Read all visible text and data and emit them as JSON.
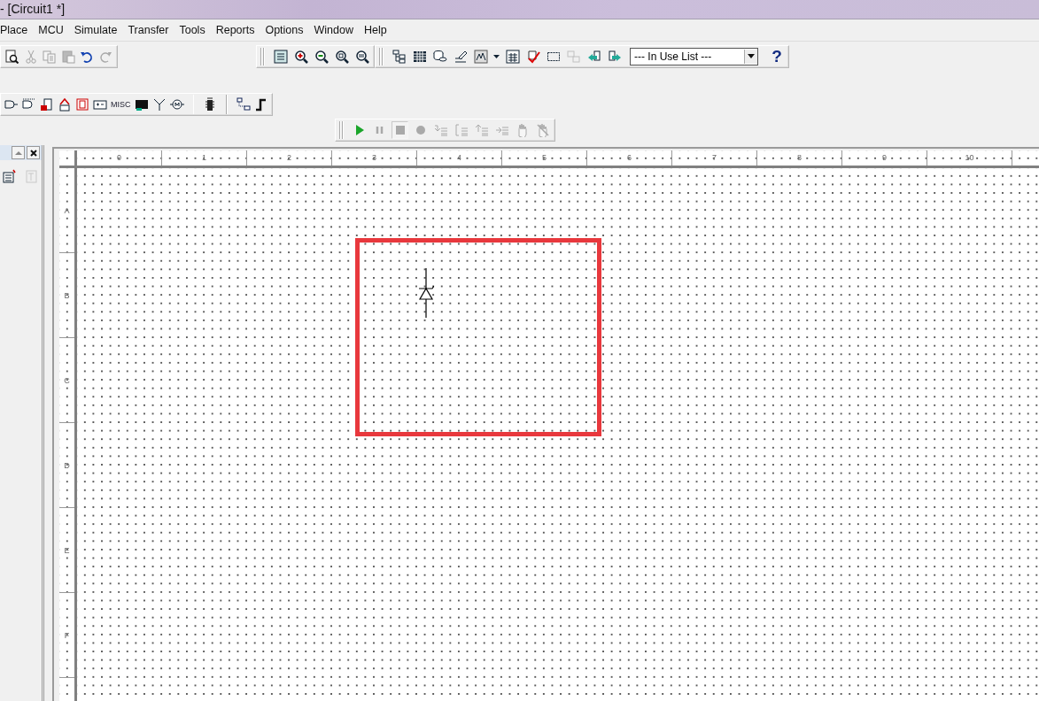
{
  "window": {
    "title": "- [Circuit1 *]"
  },
  "menu": [
    "Place",
    "MCU",
    "Simulate",
    "Transfer",
    "Tools",
    "Reports",
    "Options",
    "Window",
    "Help"
  ],
  "toolbar_edit": [
    {
      "kind": "print-preview",
      "disabled": false
    },
    {
      "kind": "cut",
      "disabled": true
    },
    {
      "kind": "copy",
      "disabled": true
    },
    {
      "kind": "paste",
      "disabled": true
    },
    {
      "kind": "undo",
      "disabled": false
    },
    {
      "kind": "redo",
      "disabled": true
    }
  ],
  "toolbar_view": [
    {
      "kind": "full-screen",
      "disabled": false
    },
    {
      "kind": "zoom-in",
      "disabled": false
    },
    {
      "kind": "zoom-out",
      "disabled": false
    },
    {
      "kind": "zoom-area",
      "disabled": false
    },
    {
      "kind": "zoom-fit",
      "disabled": false
    }
  ],
  "toolbar_main": [
    {
      "kind": "hierarchy",
      "disabled": false
    },
    {
      "kind": "spreadsheet",
      "disabled": false
    },
    {
      "kind": "database",
      "disabled": false
    },
    {
      "kind": "component-wizard",
      "disabled": false
    },
    {
      "kind": "grapher",
      "disabled": false
    },
    {
      "kind": "caret",
      "disabled": false
    },
    {
      "kind": "postprocessor",
      "disabled": false
    },
    {
      "kind": "erc",
      "disabled": false
    },
    {
      "kind": "region",
      "disabled": false
    },
    {
      "kind": "replace",
      "disabled": true
    },
    {
      "kind": "back-annotate",
      "disabled": false
    },
    {
      "kind": "forward-annotate",
      "disabled": false
    }
  ],
  "in_use_list": {
    "value": "--- In Use List ---"
  },
  "help_button": {
    "label": "?"
  },
  "toolbar_components": [
    {
      "kind": "ttl",
      "disabled": false
    },
    {
      "kind": "cmos",
      "disabled": false
    },
    {
      "kind": "digital",
      "disabled": false
    },
    {
      "kind": "mixed",
      "disabled": false
    },
    {
      "kind": "indicator",
      "disabled": false
    },
    {
      "kind": "power",
      "disabled": false
    },
    {
      "kind": "text",
      "label": "MISC",
      "disabled": false
    },
    {
      "kind": "advanced",
      "disabled": false
    },
    {
      "kind": "rf",
      "disabled": false
    },
    {
      "kind": "electromechanical",
      "disabled": false
    },
    {
      "kind": "separator"
    },
    {
      "kind": "mcu",
      "disabled": false
    },
    {
      "kind": "separator"
    },
    {
      "kind": "hierarchical-block",
      "disabled": false
    },
    {
      "kind": "bus",
      "disabled": false
    }
  ],
  "toolbar_simulation": [
    {
      "kind": "run",
      "disabled": false,
      "pressed": false
    },
    {
      "kind": "pause",
      "disabled": true,
      "pressed": false
    },
    {
      "kind": "stop",
      "disabled": true,
      "pressed": true
    },
    {
      "kind": "record",
      "disabled": true,
      "pressed": false
    },
    {
      "kind": "step-into",
      "disabled": true,
      "pressed": false
    },
    {
      "kind": "step-over",
      "disabled": true,
      "pressed": false
    },
    {
      "kind": "step-out",
      "disabled": true,
      "pressed": false
    },
    {
      "kind": "run-to-cursor",
      "disabled": true,
      "pressed": false
    },
    {
      "kind": "breakpoint",
      "disabled": true,
      "pressed": false
    },
    {
      "kind": "remove-breakpoints",
      "disabled": true,
      "pressed": false
    }
  ],
  "side_panel": {
    "buttons": [
      {
        "kind": "scroll-up"
      },
      {
        "kind": "close"
      }
    ],
    "tools": [
      {
        "kind": "new-sheet",
        "disabled": false
      },
      {
        "kind": "sheet-text",
        "disabled": true
      }
    ]
  },
  "schematic": {
    "ruler_columns": [
      "0",
      "1",
      "2",
      "3",
      "4",
      "5",
      "6",
      "7",
      "8",
      "9",
      "10"
    ],
    "ruler_rows": [
      "A",
      "B",
      "C",
      "D",
      "E",
      "F"
    ],
    "components": [
      {
        "kind": "zener-diode"
      }
    ],
    "annotations": [
      {
        "kind": "highlight-rectangle",
        "color": "#e8383d"
      }
    ]
  }
}
